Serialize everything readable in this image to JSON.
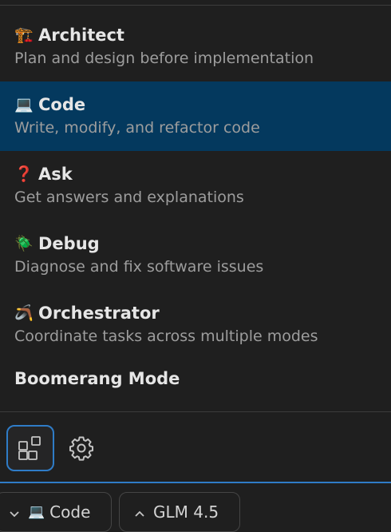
{
  "modes": [
    {
      "emoji": "🏗️",
      "name": "Architect",
      "description": "Plan and design before implementation",
      "selected": false,
      "icon": "building-construction-icon"
    },
    {
      "emoji": "💻",
      "name": "Code",
      "description": "Write, modify, and refactor code",
      "selected": true,
      "icon": "laptop-icon"
    },
    {
      "emoji": "❓",
      "name": "Ask",
      "description": "Get answers and explanations",
      "selected": false,
      "icon": "question-mark-icon"
    },
    {
      "emoji": "🪲",
      "name": "Debug",
      "description": "Diagnose and fix software issues",
      "selected": false,
      "icon": "beetle-icon"
    },
    {
      "emoji": "🪃",
      "name": "Orchestrator",
      "description": "Coordinate tasks across multiple modes",
      "selected": false,
      "icon": "boomerang-icon"
    }
  ],
  "extra_mode": {
    "name": "Boomerang Mode"
  },
  "toolbar": {
    "modes_button_icon": "marketplace-icon",
    "settings_button_icon": "gear-icon"
  },
  "footer": {
    "mode_selector": {
      "chevron": "chevron-down-icon",
      "emoji": "💻",
      "label": "Code"
    },
    "model_selector": {
      "chevron": "chevron-up-icon",
      "label": "GLM 4.5"
    }
  },
  "colors": {
    "background": "#1f1f1f",
    "selected_row": "#04395e",
    "accent": "#2f7cc7",
    "title_text": "#e6e6e6",
    "description_text": "#9d9d9d"
  }
}
